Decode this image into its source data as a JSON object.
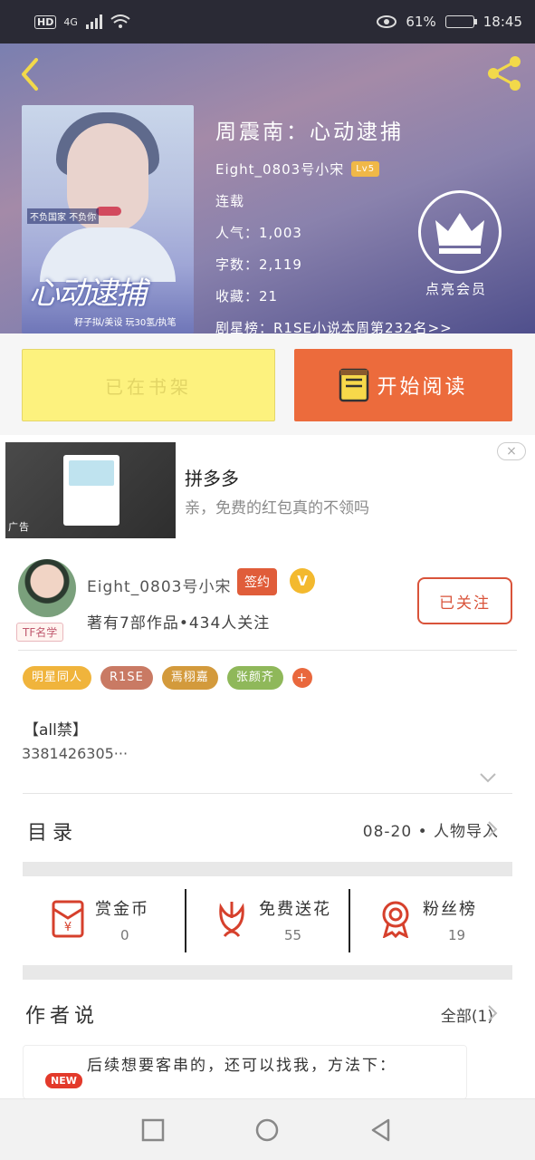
{
  "status_bar": {
    "left_icons": [
      "HD",
      "4G"
    ],
    "battery": "61%",
    "time": "18:45"
  },
  "book": {
    "cover_title": "心动逮捕",
    "cover_tag": "不负国家 不负你",
    "cover_credit": "籽子拟/美设 玩30氢/执笔",
    "title": "周震南：心动逮捕",
    "author": "Eight_0803号小宋",
    "level": "Lv5",
    "status": "连载",
    "popularity": "人气：1,003",
    "word_count": "字数：2,119",
    "favorites": "收藏：21",
    "ranking": "剧星榜：R1SE小说本周第232名>>",
    "vip_label": "点亮会员"
  },
  "actions": {
    "shelf_label": "已在书架",
    "read_label": "开始阅读"
  },
  "ad": {
    "tag": "广告",
    "title": "拼多多",
    "subtitle": "亲，免费的红包真的不领吗",
    "close": "×"
  },
  "author_card": {
    "avatar_tag": "TF名学",
    "name": "Eight_0803号小宋",
    "signed_badge": "签约",
    "v_badge": "V",
    "meta": "著有7部作品•434人关注",
    "follow_label": "已关注",
    "tags": [
      {
        "label": "明星同人",
        "color": "#f0b43c"
      },
      {
        "label": "R1SE",
        "color": "#c97a64"
      },
      {
        "label": "焉栩嘉",
        "color": "#d39a3c"
      },
      {
        "label": "张颜齐",
        "color": "#8fb85a"
      }
    ],
    "tag_more": "+",
    "desc_line1": "【all禁】",
    "desc_line2": "3381426305···"
  },
  "toc": {
    "label": "目录",
    "latest": "08-20 • 人物导入"
  },
  "stats": [
    {
      "label": "赏金币",
      "value": "0",
      "icon": "red-envelope-icon"
    },
    {
      "label": "免费送花",
      "value": "55",
      "icon": "flower-icon"
    },
    {
      "label": "粉丝榜",
      "value": "19",
      "icon": "medal-icon"
    }
  ],
  "author_says": {
    "label": "作者说",
    "all_label": "全部(1)",
    "new_badge": "NEW",
    "note": "后续想要客串的，还可以找我，方法下："
  },
  "colors": {
    "accent": "#ec6b3c",
    "shelf": "#fdf27e",
    "sign": "#e05d3a"
  }
}
